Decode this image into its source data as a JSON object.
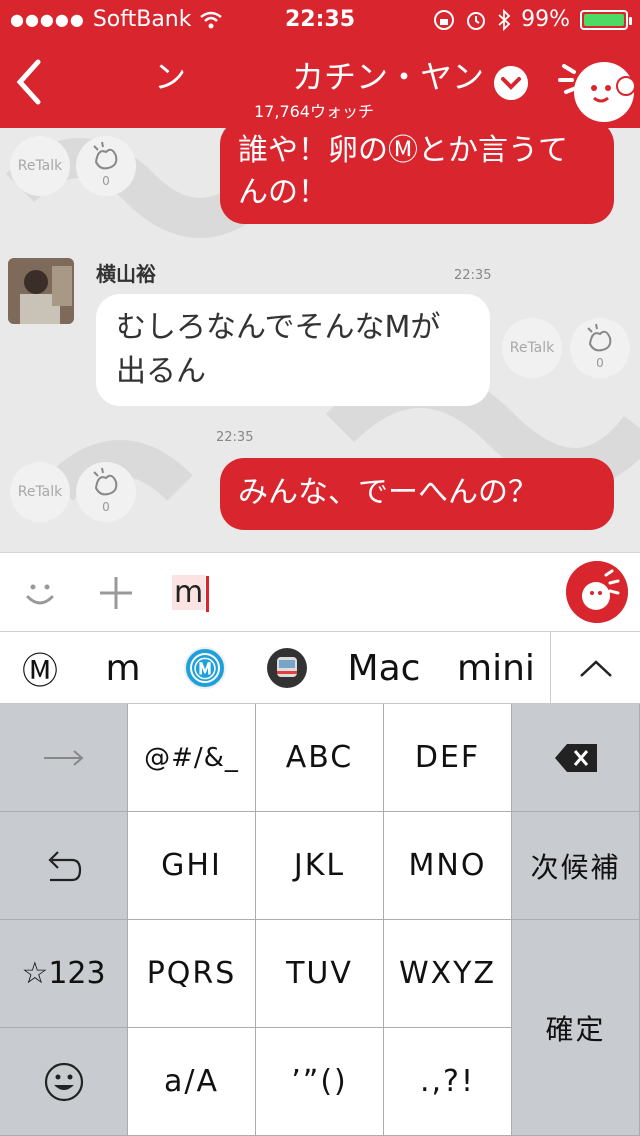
{
  "status_bar": {
    "carrier": "SoftBank",
    "time": "22:35",
    "battery": "99%",
    "battery_level": 0.99
  },
  "header": {
    "title_left_fragment": "ン",
    "title": "カチン・ヤン",
    "watch_count": "17,764ウォッチ"
  },
  "messages": [
    {
      "type": "outgoing",
      "text_line1": "誰や！卵のⓂとか言うて",
      "text_line2": "んの！",
      "retalk_label": "ReTalk",
      "clap_count": "0"
    },
    {
      "type": "incoming",
      "username": "横山裕",
      "time": "22:35",
      "text_line1": "むしろなんでそんなMが",
      "text_line2": "出るん",
      "retalk_label": "ReTalk",
      "clap_count": "0"
    },
    {
      "type": "outgoing",
      "time": "22:35",
      "text": "みんな、でーへんの？",
      "retalk_label": "ReTalk",
      "clap_count": "0"
    }
  ],
  "input": {
    "value": "m"
  },
  "suggestions": [
    "Ⓜ",
    "m",
    "Ⓜ",
    "🚇",
    "Mac",
    "mini"
  ],
  "keyboard": {
    "rows": [
      [
        "→",
        "@#/&_",
        "ABC",
        "DEF",
        "⌫"
      ],
      [
        "↺",
        "GHI",
        "JKL",
        "MNO",
        "次候補"
      ],
      [
        "☆123",
        "PQRS",
        "TUV",
        "WXYZ",
        "確定"
      ],
      [
        "☺",
        "a/A",
        "’”()",
        ".,?!"
      ]
    ]
  },
  "colors": {
    "brand_red": "#d9262e",
    "battery_green": "#4cd964",
    "metro_blue": "#1ea0dd"
  }
}
